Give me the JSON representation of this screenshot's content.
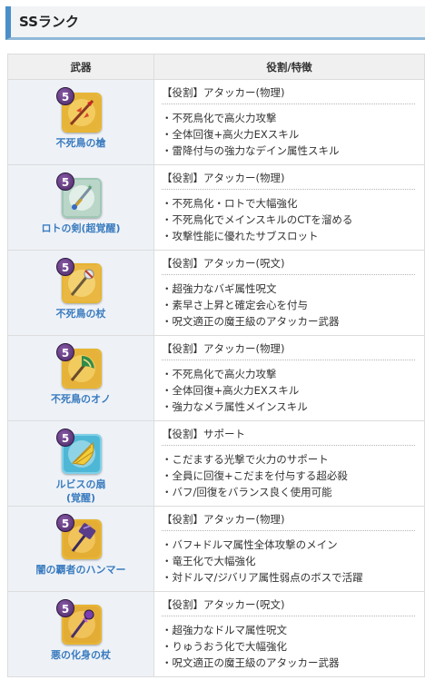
{
  "heading": "SSランク",
  "table": {
    "headers": [
      "武器",
      "役割/特徴"
    ],
    "rows": [
      {
        "name": "不死鳥の槍",
        "role_tag": "【役割】",
        "role": "アタッカー(物理)",
        "features": [
          "不死鳥化で高火力攻撃",
          "全体回復+高火力EXスキル",
          "雷降付与の強力なデイン属性スキル"
        ],
        "icon": "phoenix-spear-icon",
        "icon_bg": "#e7b43a"
      },
      {
        "name": "ロトの剣(超覚醒)",
        "role_tag": "【役割】",
        "role": "アタッカー(物理)",
        "features": [
          "不死鳥化・ロトで大幅強化",
          "不死鳥化でメインスキルのCTを溜める",
          "攻撃性能に優れたサブスロット"
        ],
        "icon": "loto-sword-icon",
        "icon_bg": "#b9d6c9"
      },
      {
        "name": "不死鳥の杖",
        "role_tag": "【役割】",
        "role": "アタッカー(呪文)",
        "features": [
          "超強力なバギ属性呪文",
          "素早さ上昇と確定会心を付与",
          "呪文適正の魔王級のアタッカー武器"
        ],
        "icon": "phoenix-staff-icon",
        "icon_bg": "#e9b742"
      },
      {
        "name": "不死鳥のオノ",
        "role_tag": "【役割】",
        "role": "アタッカー(物理)",
        "features": [
          "不死鳥化で高火力攻撃",
          "全体回復+高火力EXスキル",
          "強力なメラ属性メインスキル"
        ],
        "icon": "phoenix-axe-icon",
        "icon_bg": "#e6b23a"
      },
      {
        "name": "ルビスの扇\n(覚醒)",
        "role_tag": "【役割】",
        "role": "サポート",
        "features": [
          "こだまする光撃で火力のサポート",
          "全員に回復+こだまを付与する超必殺",
          "バフ/回復をバランス良く使用可能"
        ],
        "icon": "rubiss-fan-icon",
        "icon_bg": "#4fb7d6"
      },
      {
        "name": "闇の覇者のハンマー",
        "role_tag": "【役割】",
        "role": "アタッカー(物理)",
        "features": [
          "バフ+ドルマ属性全体攻撃のメイン",
          "竜王化で大幅強化",
          "対ドルマ/ジバリア属性弱点のボスで活躍"
        ],
        "icon": "dark-hammer-icon",
        "icon_bg": "#e4ad33"
      },
      {
        "name": "悪の化身の杖",
        "role_tag": "【役割】",
        "role": "アタッカー(呪文)",
        "features": [
          "超強力なドルマ属性呪文",
          "りゅうおう化で大幅強化",
          "呪文適正の魔王級のアタッカー武器"
        ],
        "icon": "evil-incarnation-staff-icon",
        "icon_bg": "#e3ac35"
      }
    ]
  },
  "rank_badge": "5",
  "colors": {
    "accent_blue": "#4a8fc7",
    "weapon_name": "#3a7bbf",
    "weapon_cell_bg": "#eef2f7",
    "header_bg": "#f0f0f0"
  }
}
